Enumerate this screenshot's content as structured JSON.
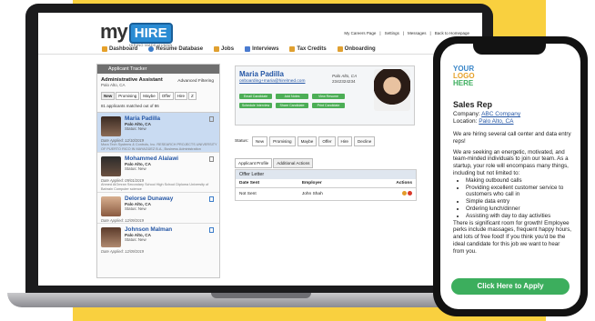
{
  "header": {
    "logo_my": "my",
    "logo_hire": "HIRE",
    "tagline": "HIRING MADE HUMAN",
    "toplinks": [
      "My Careers Page",
      "Settings",
      "Messages",
      "Back to Homepage"
    ],
    "nav": [
      {
        "label": "Dashboard",
        "icon": "dashboard-icon",
        "color": "#e6a12a"
      },
      {
        "label": "Resume Database",
        "icon": "search-icon",
        "color": "#3b7cc9"
      },
      {
        "label": "Jobs",
        "icon": "pencil-icon",
        "color": "#e0a030"
      },
      {
        "label": "Interviews",
        "icon": "people-icon",
        "color": "#4a7bd0"
      },
      {
        "label": "Tax Credits",
        "icon": "dollar-icon",
        "color": "#e0a030"
      },
      {
        "label": "Onboarding",
        "icon": "clipboard-icon",
        "color": "#e0a030"
      }
    ]
  },
  "tracker": {
    "title": "Applicant Tracker",
    "job_title": "Administrative Assistant",
    "job_location": "Palo Alto, CA",
    "advanced": "Advanced Filtering",
    "tabs": [
      "New",
      "Promising",
      "Maybe",
      "Offer",
      "Hire",
      "Z"
    ],
    "count": "81 applicants matched out of 86",
    "candidates": [
      {
        "name": "Maria Padilla",
        "city": "Palo Alto, CA",
        "status": "Status: New",
        "date": "Date Applied: 12/10/2019",
        "edu": "Mora Tech Systems & Controls, Inc. RESEARCH PROJECTS UNIVERSITY OF PUERTO RICO IN MAYAGÜEZ B.A., Business Administration"
      },
      {
        "name": "Mohammed Alalawi",
        "city": "Palo Alto, CA",
        "status": "Status: New",
        "date": "Date Applied: 09/01/2019",
        "edu": "Ahmed AlOmran Secondary School High School Diploma University of Bahrain Computer science"
      },
      {
        "name": "Delorse Dunaway",
        "city": "Palo Alto, CA",
        "status": "Status: New",
        "date": "Date Applied: 12/09/2019",
        "edu": ""
      },
      {
        "name": "Johnson Malman",
        "city": "Palo Alto, CA",
        "status": "Status: New",
        "date": "Date Applied: 12/09/2019",
        "edu": ""
      }
    ]
  },
  "profile": {
    "name": "Maria Padilla",
    "email": "onboarding+maria@hirelmed.com",
    "city": "Palo Alto, CA",
    "phone": "2342324234",
    "buttons": [
      "Email Candidate",
      "Add Notes",
      "View Resume",
      "Schedule Interview",
      "Share Candidate",
      "Print Candidate"
    ],
    "status_label": "Status:",
    "statuses": [
      "New",
      "Promising",
      "Maybe",
      "Offer",
      "Hire",
      "Decline"
    ],
    "tabs": [
      "Applicant Profile",
      "Additional Actions"
    ],
    "offer": {
      "title": "Offer Letter",
      "headers": [
        "Date Sent",
        "Employer",
        "Actions"
      ],
      "row": [
        "Not Sent",
        "John Shah",
        ""
      ]
    }
  },
  "phone": {
    "logo": [
      "YOUR",
      "LOGO",
      "HERE"
    ],
    "job_title": "Sales Rep",
    "company_label": "Company:",
    "company": "ABC Company",
    "location_label": "Location:",
    "location": "Palo Alto, CA",
    "intro": "We are hiring several call center and data entry reps!",
    "body": "We are seeking an energetic, motivated, and team-minded individuals to join our team. As a startup, your role will encompass many things, including but not limited to:",
    "bullets": [
      "Making outbound calls",
      "Providing excellent customer service to customers who call in",
      "Simple data entry",
      "Ordering lunch/dinner",
      "Assisting with day to day activities"
    ],
    "outro": "There is significant room for growth! Employee perks include massages, frequent happy hours, and lots of free food! If you think you'd be the ideal candidate for this job we want to hear from you.",
    "apply": "Click Here to Apply"
  },
  "colors": {
    "accent": "#2a8bd3",
    "yellow": "#f9d03f",
    "green": "#3cae5d",
    "selected_row": "#c9dbf2"
  }
}
